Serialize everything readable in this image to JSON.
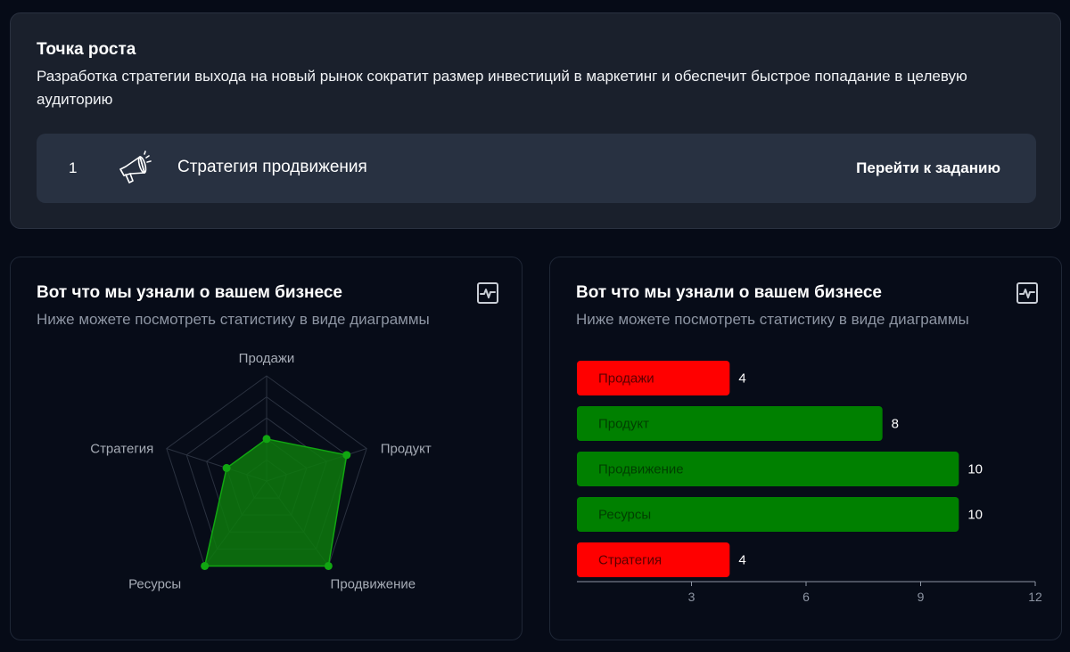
{
  "growth": {
    "title": "Точка роста",
    "description": "Разработка стратегии выхода на новый рынок сократит размер инвестиций в маркетинг и обеспечит быстрое попадание в целевую аудиторию",
    "task": {
      "number": "1",
      "icon": "megaphone-icon",
      "label": "Стратегия продвижения",
      "link_label": "Перейти к заданию"
    }
  },
  "panels": [
    {
      "title": "Вот что мы узнали о вашем бизнесе",
      "subtitle": "Ниже можете посмотреть статистику в виде диаграммы",
      "icon": "chart-pulse-icon"
    },
    {
      "title": "Вот что мы узнали о вашем бизнесе",
      "subtitle": "Ниже можете посмотреть статистику в виде диаграммы",
      "icon": "chart-pulse-icon"
    }
  ],
  "chart_data": [
    {
      "type": "radar",
      "categories": [
        "Продажи",
        "Продукт",
        "Продвижение",
        "Ресурсы",
        "Стратегия"
      ],
      "values": [
        4,
        8,
        10,
        10,
        4
      ],
      "range": [
        0,
        10
      ],
      "levels": 5,
      "colors": {
        "fill": "#0d7a0d",
        "point": "#11a611",
        "grid": "#2b3240",
        "label": "#a6acb6"
      }
    },
    {
      "type": "bar",
      "orientation": "horizontal",
      "categories": [
        "Продажи",
        "Продукт",
        "Продвижение",
        "Ресурсы",
        "Стратегия"
      ],
      "values": [
        4,
        8,
        10,
        10,
        4
      ],
      "xlim": [
        0,
        12
      ],
      "xticks": [
        3,
        6,
        9,
        12
      ],
      "colors": {
        "low": "#ff0000",
        "high": "#008000",
        "axis": "#8d95a3",
        "label_low": "#5a0000",
        "label_high": "#003f00"
      }
    }
  ]
}
